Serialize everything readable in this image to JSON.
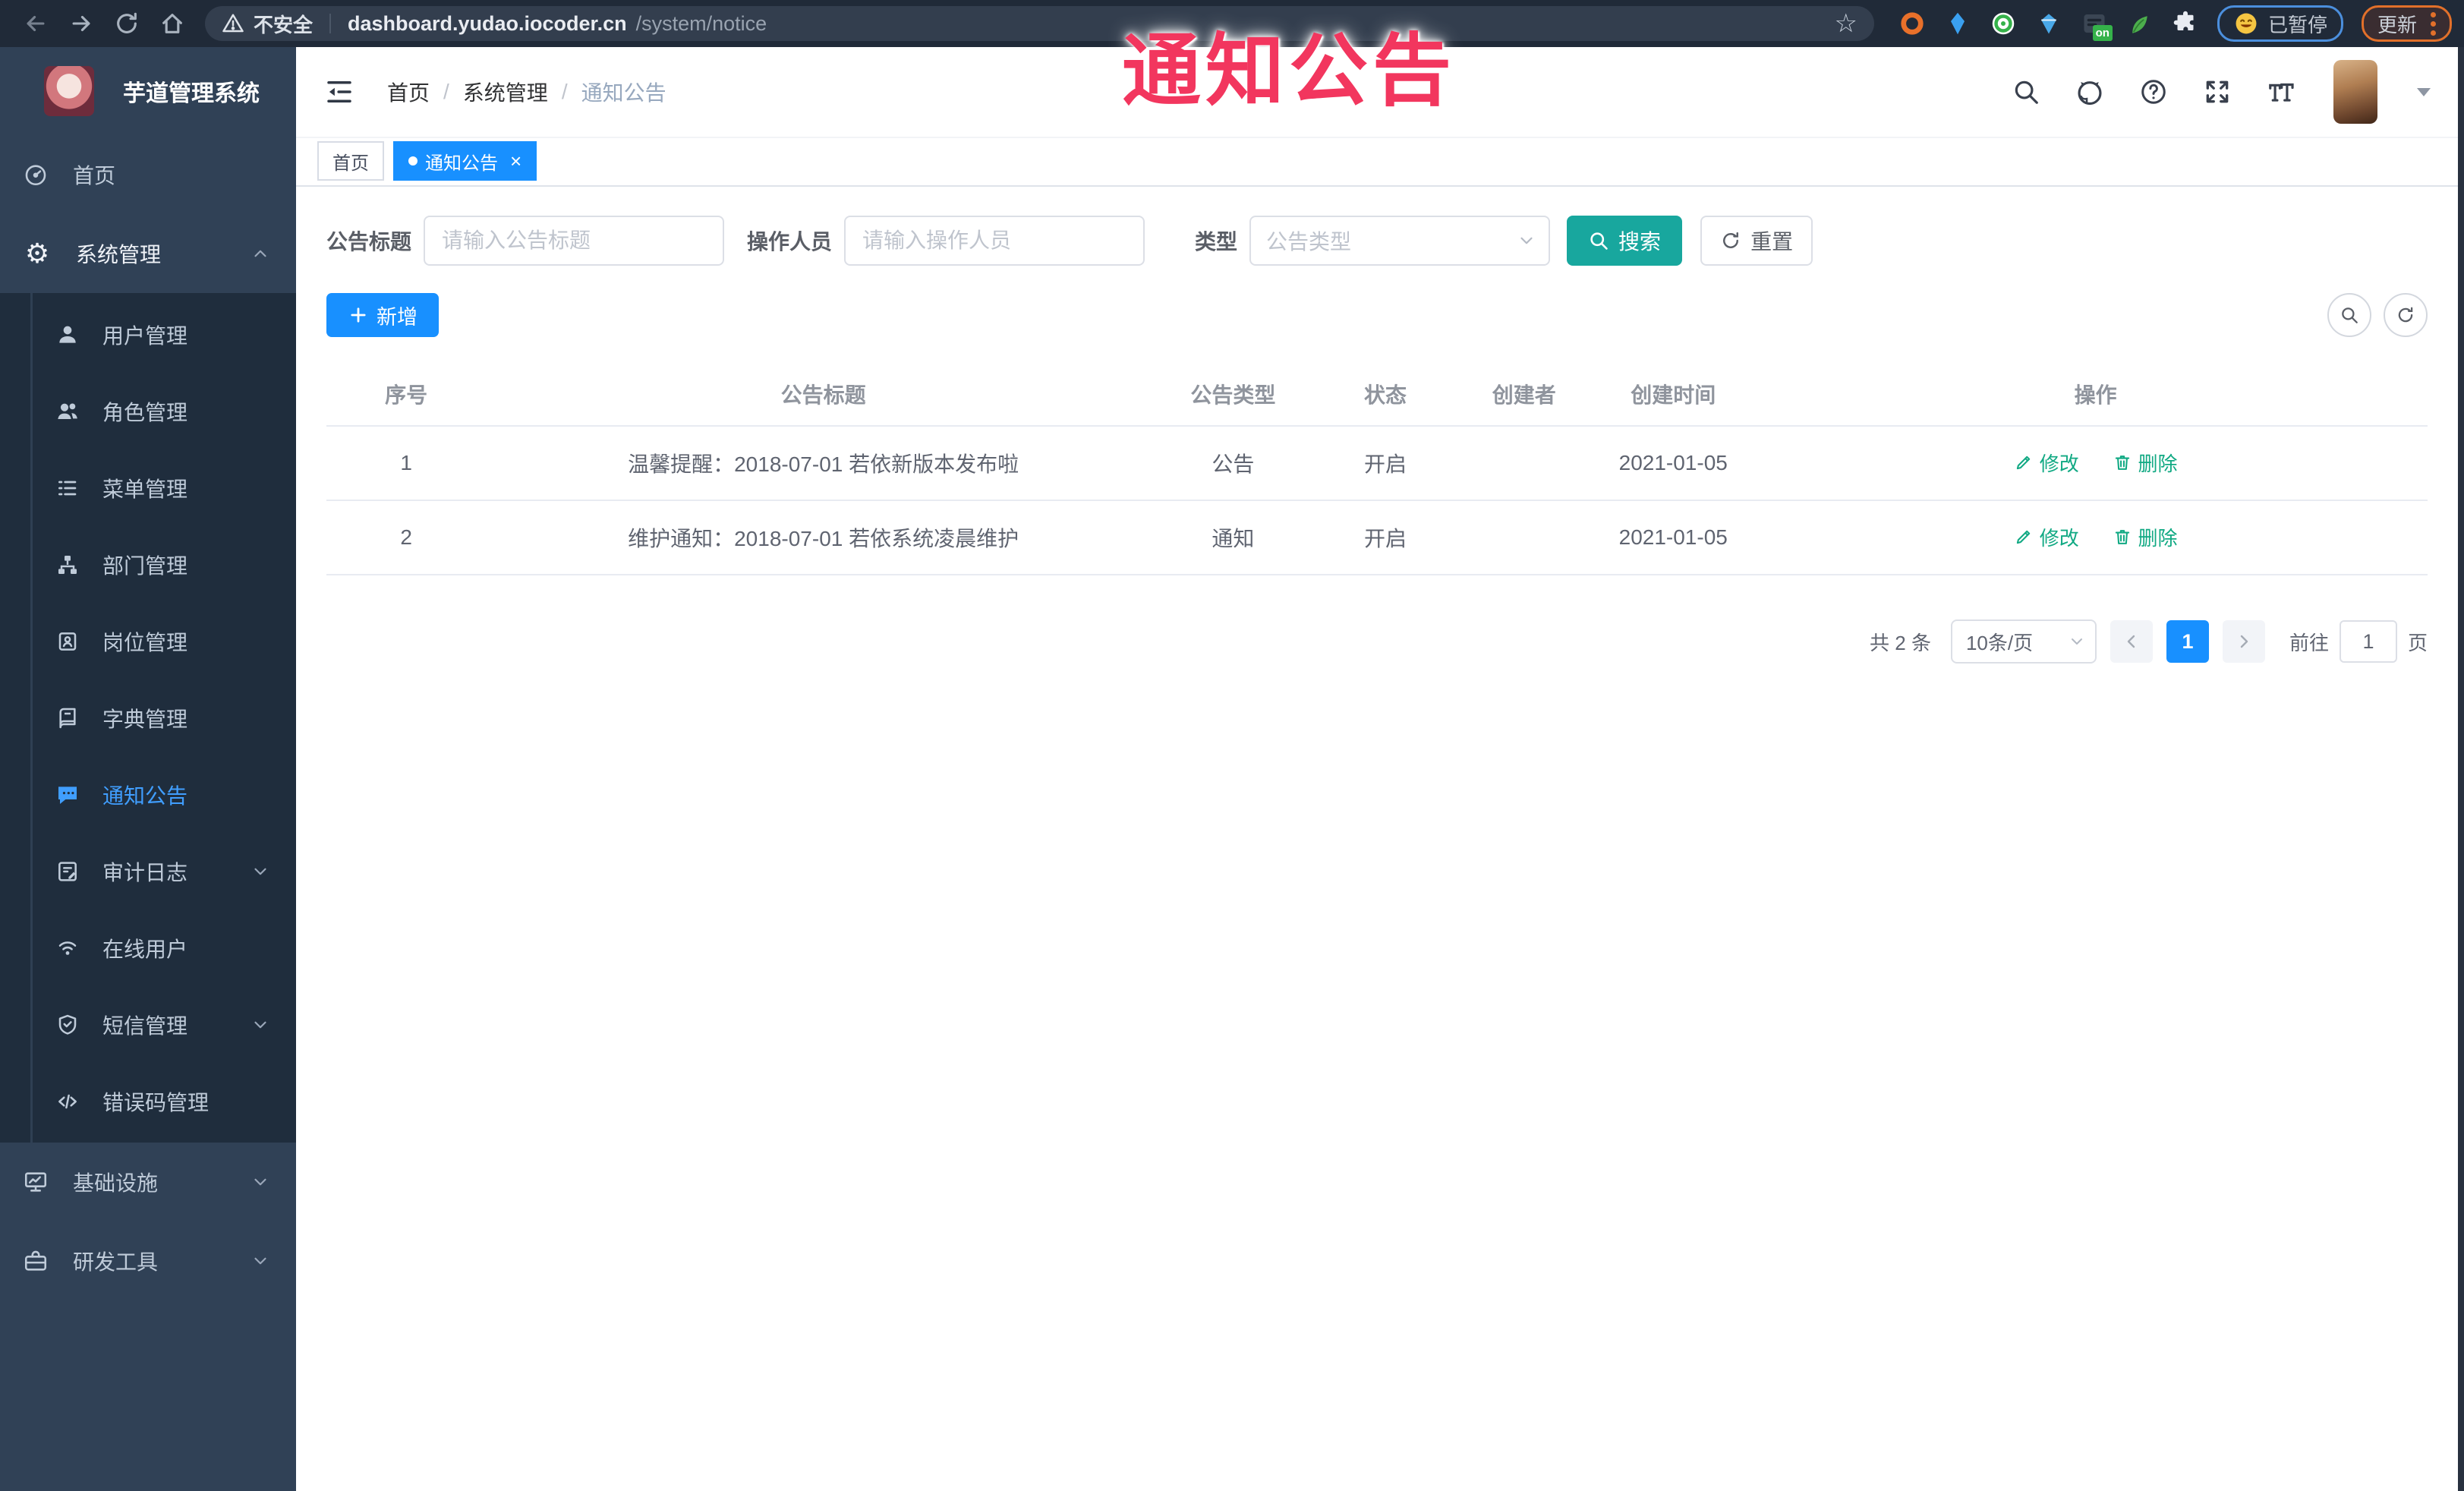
{
  "annotation": {
    "text": "通知公告"
  },
  "browser": {
    "security_label": "不安全",
    "url_host": "dashboard.yudao.iocoder.cn",
    "url_path": "/system/notice",
    "extension_badge": "on",
    "paused_label": "已暂停",
    "update_label": "更新"
  },
  "icons": {
    "star": "☆",
    "gear": "⚙",
    "close": "×"
  },
  "sidebar": {
    "title": "芋道管理系统",
    "menu_home": "首页",
    "menu_system": "系统管理",
    "submenu": [
      "用户管理",
      "角色管理",
      "菜单管理",
      "部门管理",
      "岗位管理",
      "字典管理",
      "通知公告",
      "审计日志",
      "在线用户",
      "短信管理",
      "错误码管理"
    ],
    "bottom": [
      "基础设施",
      "研发工具"
    ]
  },
  "header": {
    "breadcrumb": [
      "首页",
      "系统管理",
      "通知公告"
    ],
    "breadcrumb_separator": "/"
  },
  "tabs": [
    {
      "label": "首页"
    },
    {
      "label": "通知公告"
    }
  ],
  "filters": {
    "title_label": "公告标题",
    "title_placeholder": "请输入公告标题",
    "operator_label": "操作人员",
    "operator_placeholder": "请输入操作人员",
    "type_label": "类型",
    "type_placeholder": "公告类型",
    "search_label": "搜索",
    "reset_label": "重置"
  },
  "toolbar": {
    "add_label": "新增"
  },
  "table": {
    "headers": [
      "序号",
      "公告标题",
      "公告类型",
      "状态",
      "创建者",
      "创建时间",
      "操作"
    ],
    "rows": [
      {
        "no": "1",
        "title": "温馨提醒：2018-07-01 若依新版本发布啦",
        "type": "公告",
        "status": "开启",
        "creator": "",
        "created": "2021-01-05",
        "edit": "修改",
        "delete": "删除"
      },
      {
        "no": "2",
        "title": "维护通知：2018-07-01 若依系统凌晨维护",
        "type": "通知",
        "status": "开启",
        "creator": "",
        "created": "2021-01-05",
        "edit": "修改",
        "delete": "删除"
      }
    ]
  },
  "pagination": {
    "total": "共 2 条",
    "page_size": "10条/页",
    "current": "1",
    "goto_label": "前往",
    "goto_value": "1",
    "page_unit": "页"
  },
  "colors": {
    "primary_blue": "#1890ff",
    "sidebar_bg": "#304156",
    "submenu_bg": "#1f2d3d",
    "sidebar_active": "#409eff",
    "search_teal": "#18a79e",
    "op_link_green": "#11a983",
    "annotation_red": "#f2365e",
    "browser_bar": "#202a38"
  }
}
